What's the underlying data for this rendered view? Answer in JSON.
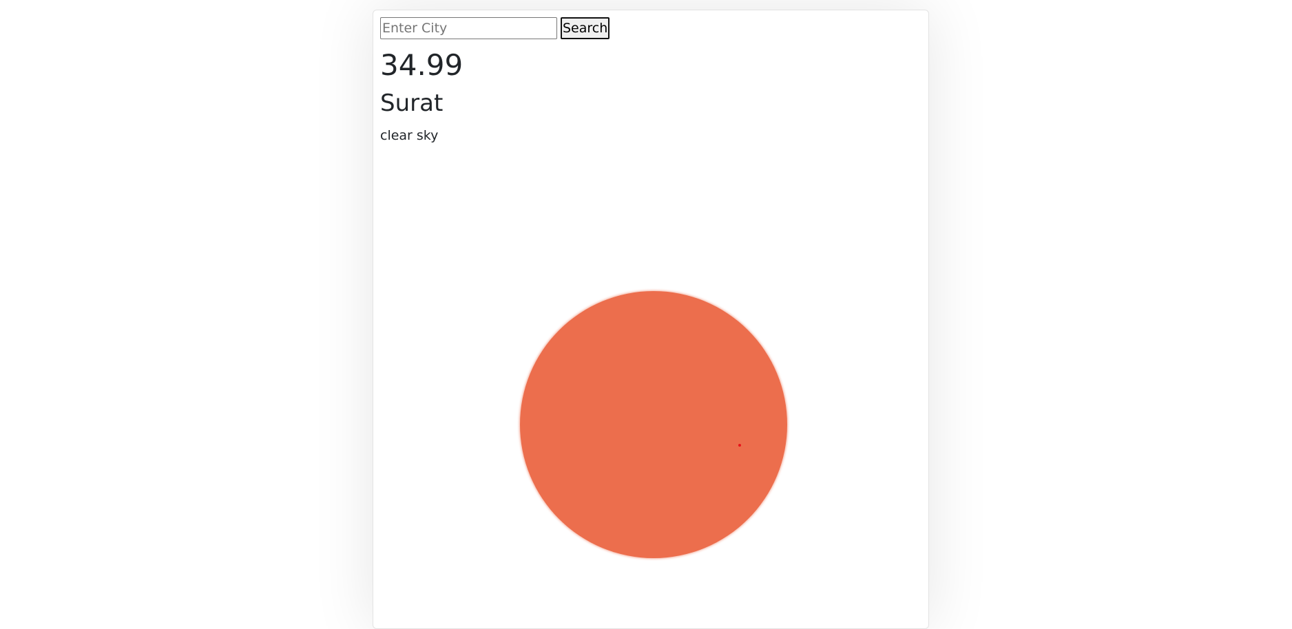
{
  "search": {
    "placeholder": "Enter City",
    "value": "",
    "button_label": "Search"
  },
  "weather": {
    "temperature": "34.99",
    "city": "Surat",
    "description": "clear sky"
  },
  "illustration": {
    "icon": "sun-icon",
    "color": "#ec6e4d"
  }
}
